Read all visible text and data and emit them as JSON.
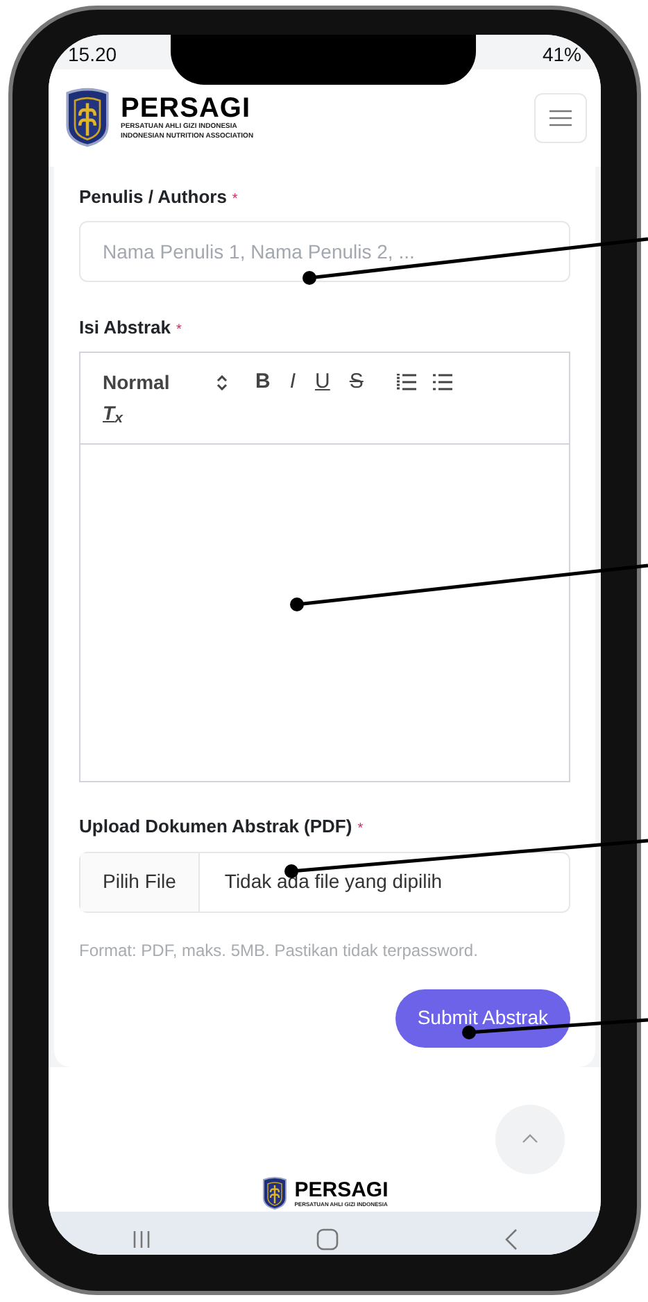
{
  "status_bar": {
    "time": "15.20",
    "battery": "41%"
  },
  "header": {
    "brand": "PERSAGI",
    "subtitle_1": "PERSATUAN AHLI GIZI INDONESIA",
    "subtitle_2": "INDONESIAN NUTRITION ASSOCIATION"
  },
  "form": {
    "authors": {
      "label": "Penulis / Authors",
      "required": "*",
      "placeholder": "Nama Penulis 1, Nama Penulis 2, ..."
    },
    "abstract": {
      "label": "Isi Abstrak",
      "required": "*",
      "format": "Normal",
      "toolbar": [
        {
          "label": "B",
          "kind": "bold"
        },
        {
          "label": "I",
          "kind": "italic"
        },
        {
          "label": "U",
          "kind": "underline"
        },
        {
          "label": "S",
          "kind": "strike"
        }
      ],
      "clear_format": "T$_{x}$"
    },
    "upload": {
      "label": "Upload Dokumen Abstrak (PDF)",
      "required": "*",
      "button": "Pilih File",
      "status": "Tidak ada file yang dipilih",
      "hint": "Format: PDF, maks. 5MB. Pastikan tidak terpassword."
    },
    "submit": "Submit Abstrak"
  },
  "footer": {
    "brand": "PERSAGI",
    "subtitle": "PERSATUAN AHLI GIZI INDONESIA"
  }
}
